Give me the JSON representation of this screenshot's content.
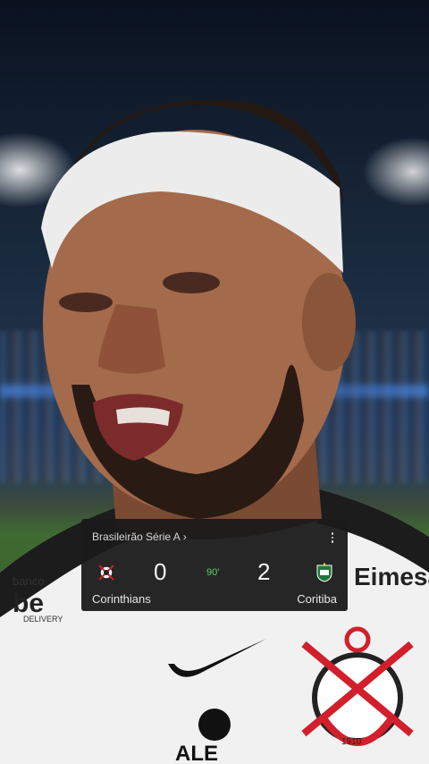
{
  "scorecard": {
    "league": "Brasileirão Série A",
    "league_chevron": "›",
    "minute": "90'",
    "home": {
      "name": "Corinthians",
      "score": "0",
      "crest": "corinthians-crest-icon"
    },
    "away": {
      "name": "Coritiba",
      "score": "2",
      "crest": "coritiba-crest-icon"
    }
  },
  "shirt": {
    "sponsor_left": "banco be DELIVERY",
    "sponsor_right": "Eimesa",
    "sponsor_bottom": "ALE"
  },
  "colors": {
    "accent_green": "#5fd16e",
    "card_bg": "#1a1a1a",
    "crest_red": "#d21f2b"
  }
}
